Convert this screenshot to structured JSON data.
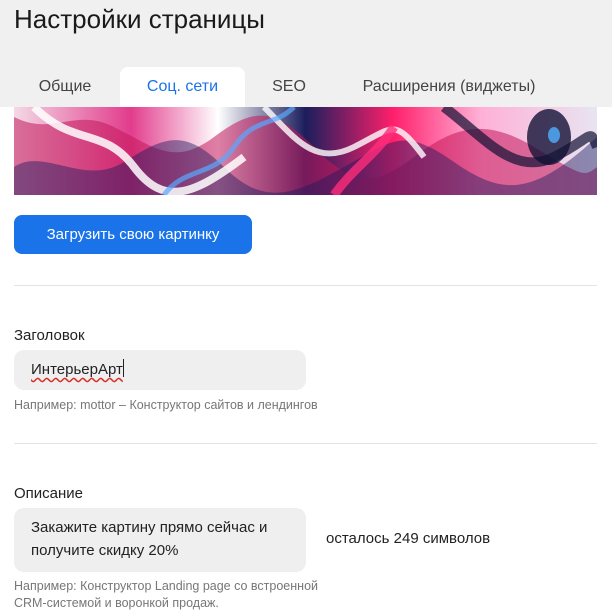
{
  "header": {
    "title": "Настройки страницы",
    "tabs": [
      {
        "label": "Общие",
        "active": false
      },
      {
        "label": "Соц. сети",
        "active": true
      },
      {
        "label": "SEO",
        "active": false
      },
      {
        "label": "Расширения (виджеты)",
        "active": false
      }
    ]
  },
  "cover": {
    "upload_button": "Загрузить свою картинку"
  },
  "title_field": {
    "label": "Заголовок",
    "value": "ИнтерьерАрт",
    "hint": "Например: mottor – Конструктор сайтов и лендингов"
  },
  "description_field": {
    "label": "Описание",
    "value_line1": "Закажите картину прямо сейчас и",
    "value_line2": "получите скидку 20%",
    "counter": "осталось 249 символов",
    "hint_line1": "Например: Конструктор Landing page со встроенной",
    "hint_line2": "CRM-системой и воронкой продаж."
  },
  "colors": {
    "accent": "#1a73e8",
    "header_bg": "#f0f0f0",
    "input_bg": "#efefef"
  }
}
